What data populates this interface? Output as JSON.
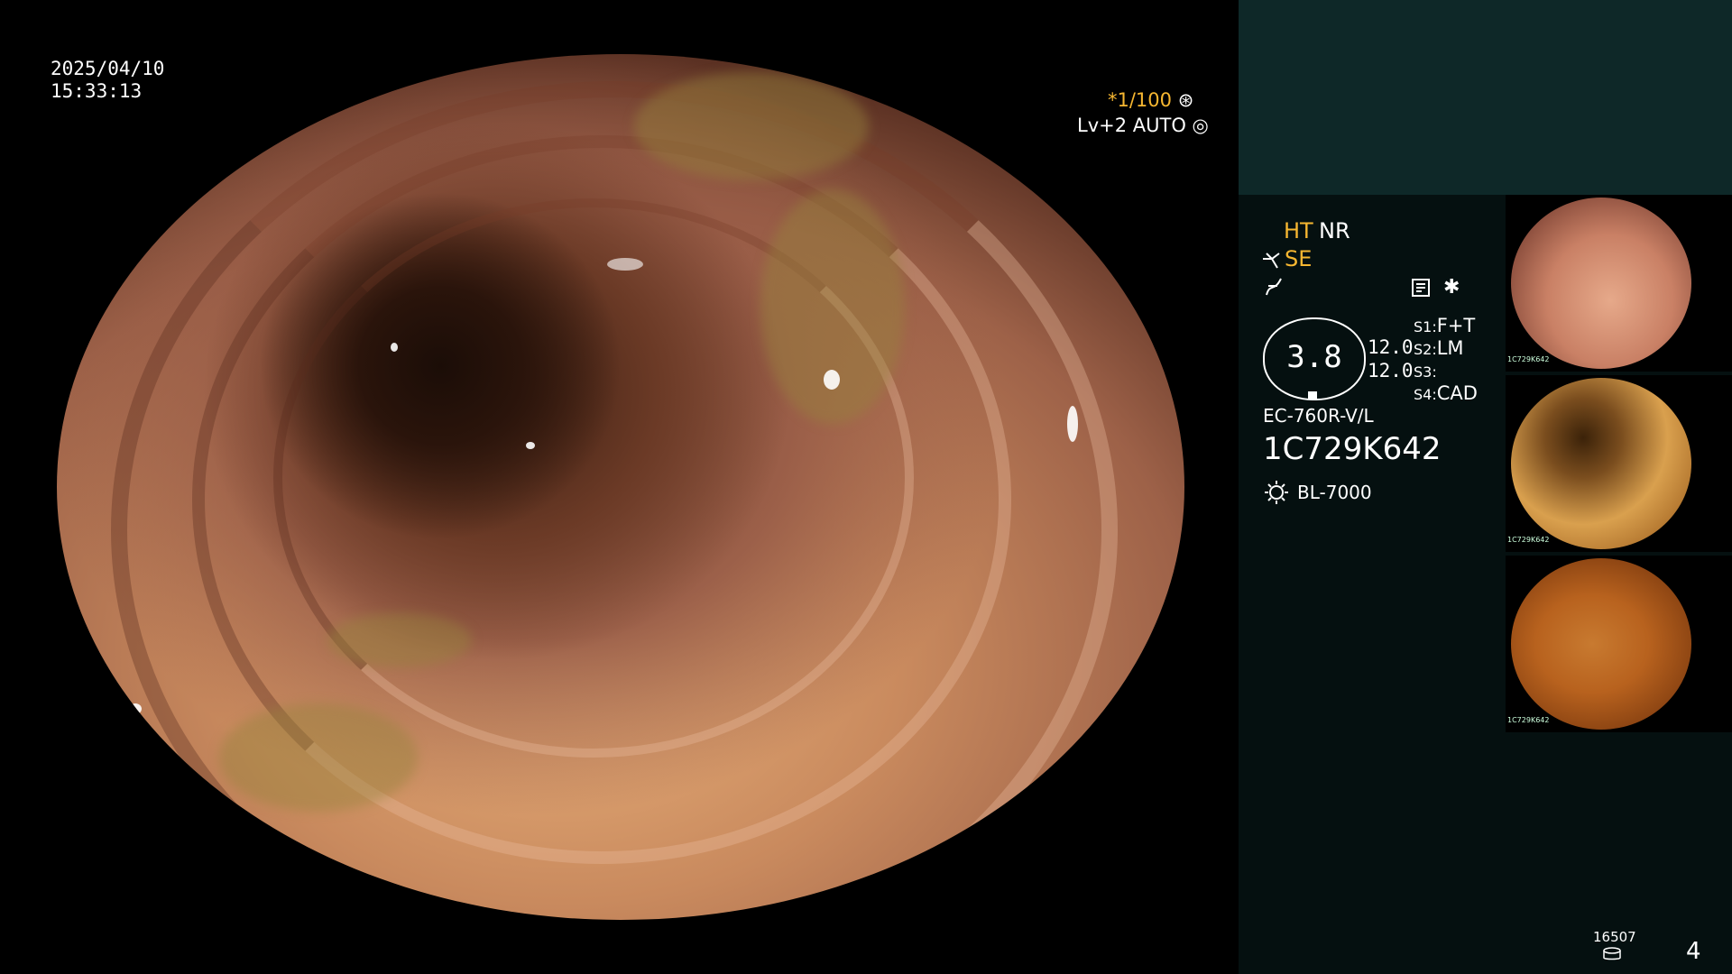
{
  "video": {
    "date": "2025/04/10",
    "time": "15:33:13",
    "shutter": "*1/100",
    "level_mode": "Lv+2 AUTO"
  },
  "panel": {
    "ht": "HT",
    "nr": "NR",
    "se": "SE",
    "scope_value": "3.8",
    "side_value_1": "12.0",
    "side_value_2": "12.0",
    "s1_label": "S1:",
    "s1_value": "F+T",
    "s2_label": "S2:",
    "s2_value": "LM",
    "s3_label": "S3:",
    "s3_value": "",
    "s4_label": "S4:",
    "s4_value": "CAD",
    "scope_model": "EC-760R-V/L",
    "serial": "1C729K642",
    "light_source": "BL-7000",
    "counter": "16507",
    "image_count": "4"
  },
  "thumbnails": [
    {
      "serial": "1C729K642",
      "tone": "#c98065"
    },
    {
      "serial": "1C729K642",
      "tone": "#c98a3a"
    },
    {
      "serial": "1C729K642",
      "tone": "#b8621e"
    }
  ],
  "colors": {
    "accent_yellow": "#f7b731",
    "panel_bg": "#051010",
    "panel_top_bg": "#0e2828"
  },
  "icons": {
    "shutter_icon": "aperture-icon",
    "auto_icon": "iris-icon",
    "se_icon": "scope-angle-icon",
    "curve_icon": "curve-icon",
    "record_icon": "record-icon",
    "star_icon": "asterisk-icon",
    "light_icon": "light-source-icon",
    "disk_icon": "disk-icon"
  }
}
